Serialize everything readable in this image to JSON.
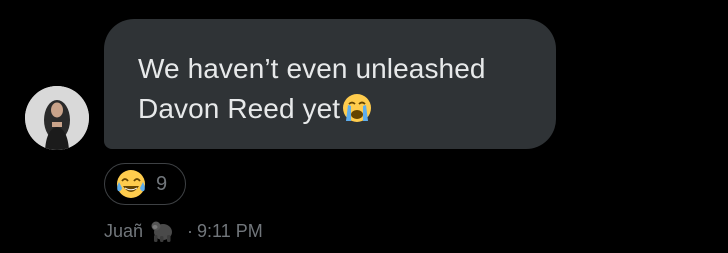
{
  "message": {
    "line1": "We haven’t even unleashed",
    "line2": "Davon Reed yet",
    "inline_emoji": "loudly-crying-face-emoji"
  },
  "reaction": {
    "emoji": "face-with-tears-of-joy-emoji",
    "count": "9"
  },
  "meta": {
    "sender": "Juañ",
    "sender_emoji": "gorilla-emoji",
    "separator": "·",
    "time": "9:11 PM"
  },
  "colors": {
    "background": "#000000",
    "bubble": "#2f3336",
    "message_text": "#e7e9ea",
    "meta_text": "#71767b",
    "reaction_border": "#3e4144"
  }
}
